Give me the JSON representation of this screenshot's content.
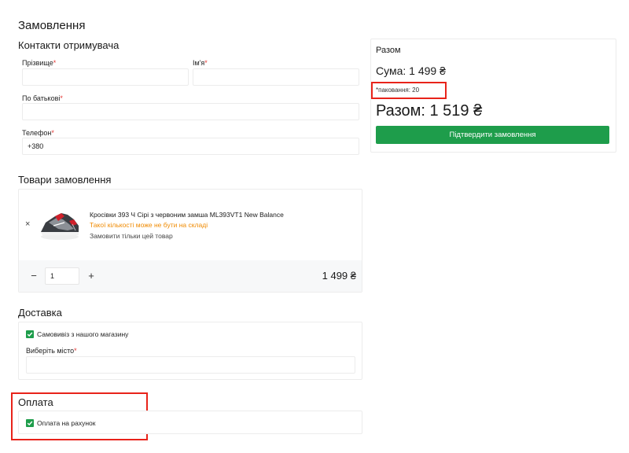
{
  "page": {
    "title": "Замовлення"
  },
  "contacts": {
    "title": "Контакти отримувача",
    "surname_label": "Прізвище",
    "name_label": "Ім'я",
    "patronymic_label": "По батькові",
    "phone_label": "Телефон",
    "phone_value": "+380",
    "required_mark": "*"
  },
  "items": {
    "title": "Товари замовлення",
    "product_name": "Кросівки 393 Ч Сірі з червоним замша ML393VT1 New Balance",
    "stock_warning": "Такої кількості може не бути на складі",
    "order_only_link": "Замовити тільки цей товар",
    "quantity": "1",
    "line_price": "1 499 ₴",
    "remove_icon": "×",
    "minus_icon": "−",
    "plus_icon": "+"
  },
  "delivery": {
    "title": "Доставка",
    "pickup_label": "Самовивіз з нашого магазину",
    "city_label": "Виберіть місто"
  },
  "payment": {
    "title": "Оплата",
    "invoice_label": "Оплата на рахунок"
  },
  "summary": {
    "title": "Разом",
    "sum_text": "Сума: 1 499 ₴",
    "packaging_text": "*паковання: 20",
    "total_text": "Разом: 1 519 ₴",
    "confirm_label": "Підтвердити замовлення"
  },
  "colors": {
    "accent_green": "#1e9d4b",
    "warning_orange": "#f08a00",
    "required_red": "#e53935",
    "highlight_red": "#e8231a"
  }
}
